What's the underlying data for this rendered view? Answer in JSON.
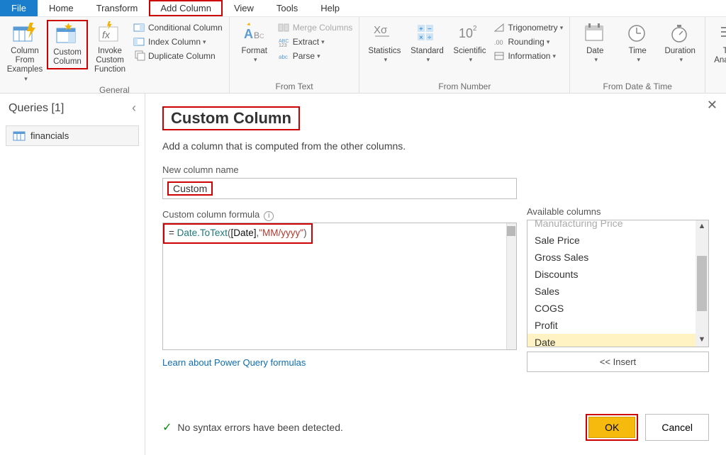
{
  "menu": {
    "file": "File",
    "home": "Home",
    "transform": "Transform",
    "add_column": "Add Column",
    "view": "View",
    "tools": "Tools",
    "help": "Help"
  },
  "ribbon": {
    "general": {
      "label": "General",
      "column_from_examples": "Column From Examples",
      "custom_column": "Custom Column",
      "invoke_custom_function": "Invoke Custom Function",
      "conditional_column": "Conditional Column",
      "index_column": "Index Column",
      "duplicate_column": "Duplicate Column"
    },
    "from_text": {
      "label": "From Text",
      "format": "Format",
      "merge_columns": "Merge Columns",
      "extract": "Extract",
      "parse": "Parse"
    },
    "from_number": {
      "label": "From Number",
      "statistics": "Statistics",
      "standard": "Standard",
      "scientific": "Scientific",
      "trigonometry": "Trigonometry",
      "rounding": "Rounding",
      "information": "Information"
    },
    "from_date_time": {
      "label": "From Date & Time",
      "date": "Date",
      "time": "Time",
      "duration": "Duration"
    },
    "text_analytics": {
      "label": "Text Analytics"
    }
  },
  "sidebar": {
    "header": "Queries [1]",
    "collapse_glyph": "‹",
    "items": [
      {
        "label": "financials"
      }
    ]
  },
  "dialog": {
    "title": "Custom Column",
    "subtitle": "Add a column that is computed from the other columns.",
    "name_label": "New column name",
    "name_value": "Custom",
    "formula_label": "Custom column formula",
    "formula_prefix": "= ",
    "formula_fn": "Date.ToText",
    "formula_field": "[Date]",
    "formula_str": "\"MM/yyyy\"",
    "available_label": "Available columns",
    "available_partial": "Manufacturing Price",
    "available": [
      "Sale Price",
      "Gross Sales",
      "Discounts",
      "Sales",
      "COGS",
      "Profit",
      "Date"
    ],
    "selected_available": "Date",
    "insert": "<< Insert",
    "learn": "Learn about Power Query formulas",
    "status": "No syntax errors have been detected.",
    "ok": "OK",
    "cancel": "Cancel"
  }
}
